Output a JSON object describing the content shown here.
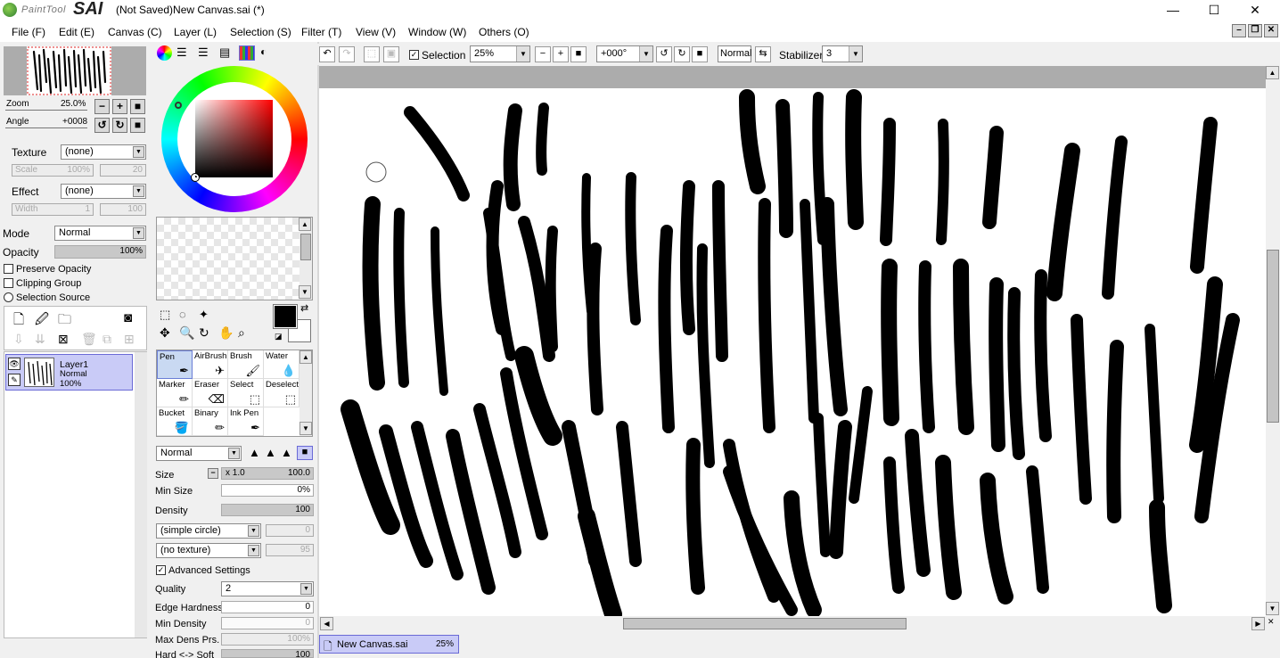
{
  "titlebar": {
    "logo_text": "PaintTool",
    "logo_brand": "SAI",
    "title": "(Not Saved)New Canvas.sai (*)",
    "min": "—",
    "max": "☐",
    "close": "✕"
  },
  "menu": [
    "File (F)",
    "Edit (E)",
    "Canvas (C)",
    "Layer (L)",
    "Selection (S)",
    "Filter (T)",
    "View (V)",
    "Window (W)",
    "Others (O)"
  ],
  "navigator": {
    "zoom_label": "Zoom",
    "zoom_value": "25.0%",
    "angle_label": "Angle",
    "angle_value": "+0008"
  },
  "texture": {
    "label": "Texture",
    "value": "(none)",
    "scale_label": "Scale",
    "scale_value": "100%",
    "scale_num": "20"
  },
  "effect": {
    "label": "Effect",
    "value": "(none)",
    "width_label": "Width",
    "width_value": "1",
    "width_num": "100"
  },
  "layer_props": {
    "mode_label": "Mode",
    "mode_value": "Normal",
    "opacity_label": "Opacity",
    "opacity_value": "100%",
    "preserve_opacity": "Preserve Opacity",
    "clipping_group": "Clipping Group",
    "selection_source": "Selection Source"
  },
  "layer": {
    "name": "Layer1",
    "mode": "Normal",
    "opacity": "100%"
  },
  "tools": [
    {
      "label": "Pen",
      "icon": "✒"
    },
    {
      "label": "AirBrush",
      "icon": "✈"
    },
    {
      "label": "Brush",
      "icon": "🖌"
    },
    {
      "label": "Water",
      "icon": "💧"
    },
    {
      "label": "Marker",
      "icon": "✏"
    },
    {
      "label": "Eraser",
      "icon": "⌫"
    },
    {
      "label": "Select",
      "icon": "⬚"
    },
    {
      "label": "Deselect",
      "icon": "⬚"
    },
    {
      "label": "Bucket",
      "icon": "🪣"
    },
    {
      "label": "Binary",
      "icon": "✏"
    },
    {
      "label": "Ink Pen",
      "icon": "✒"
    }
  ],
  "brush": {
    "blend_mode": "Normal",
    "size_label": "Size",
    "size_mult": "x 1.0",
    "size_value": "100.0",
    "min_size_label": "Min Size",
    "min_size_value": "0%",
    "density_label": "Density",
    "density_value": "100",
    "shape": "(simple circle)",
    "shape_value": "0",
    "texture": "(no texture)",
    "texture_value": "95",
    "advanced_label": "Advanced Settings",
    "quality_label": "Quality",
    "quality_value": "2",
    "edge_hardness_label": "Edge Hardness",
    "edge_hardness_value": "0",
    "min_density_label": "Min Density",
    "min_density_value": "0",
    "max_dens_label": "Max Dens Prs.",
    "max_dens_value": "100%",
    "hard_soft_label": "Hard <-> Soft",
    "hard_soft_value": "100"
  },
  "toolbar": {
    "selection_label": "Selection",
    "zoom_value": "25%",
    "angle_value": "+000°",
    "blend_mode": "Normal",
    "stabilizer_label": "Stabilizer",
    "stabilizer_value": "3"
  },
  "canvas_tab": {
    "name": "New Canvas.sai",
    "zoom": "25%"
  },
  "colors": {
    "primary": "#000000",
    "secondary": "#ffffff",
    "selected_layer": "#c9cbf7",
    "accent": "#6a6ad6"
  }
}
